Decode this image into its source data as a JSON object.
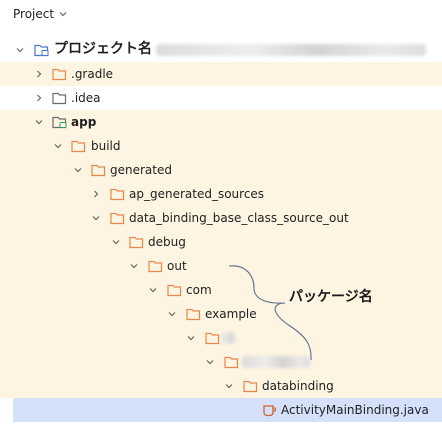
{
  "panel": {
    "title": "Project"
  },
  "tree": {
    "root_label": "プロジェクト名",
    "gradle": ".gradle",
    "idea": ".idea",
    "app": "app",
    "build": "build",
    "generated": "generated",
    "ap_generated_sources": "ap_generated_sources",
    "data_binding": "data_binding_base_class_source_out",
    "debug": "debug",
    "out": "out",
    "com": "com",
    "example": "example",
    "databinding": "databinding",
    "activity_file": "ActivityMainBinding.java"
  },
  "annotation": {
    "label": "パッケージ名"
  },
  "colors": {
    "excluded_row": "#fdf4e2",
    "selected_row": "#d5e1fb",
    "folder_orange": "#e8864c",
    "module_blue": "#4a78c8",
    "module_green": "#3a9a5a",
    "java_orange": "#d3622a"
  }
}
